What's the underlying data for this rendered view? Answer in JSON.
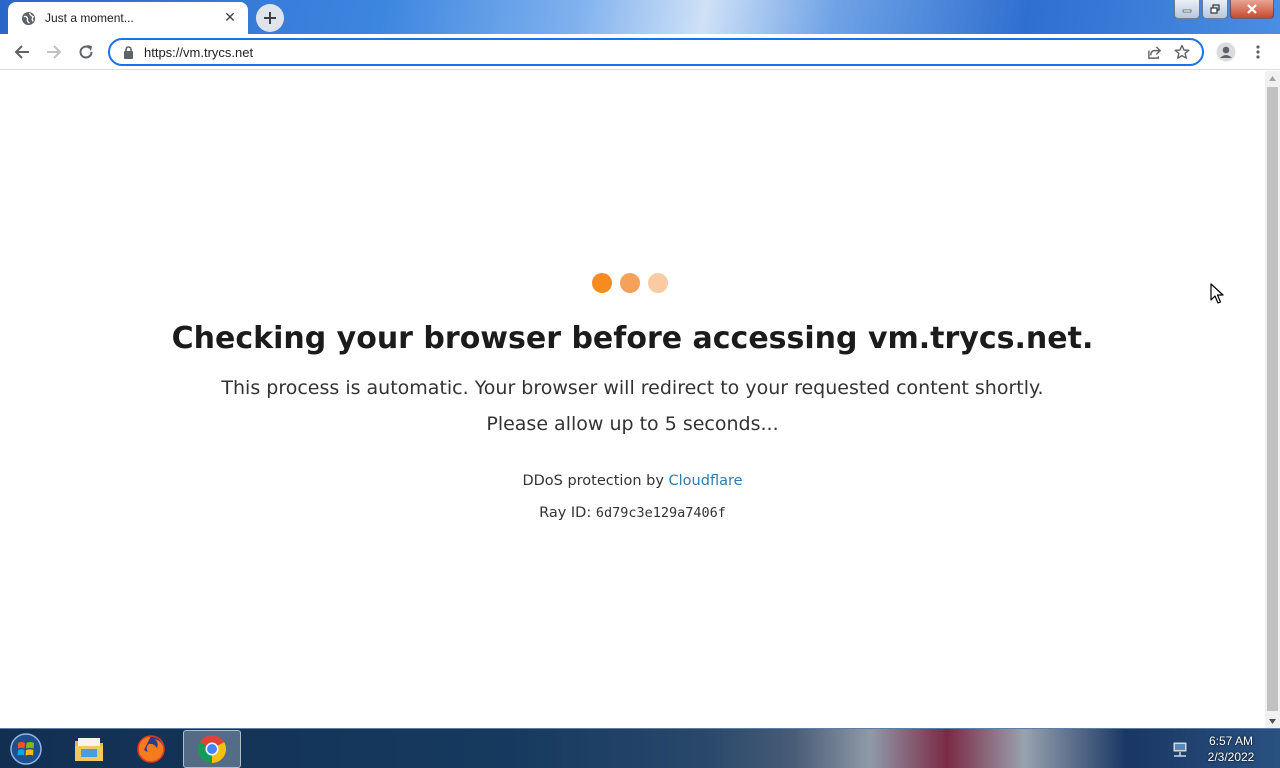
{
  "browser": {
    "tab": {
      "title": "Just a moment...",
      "favicon": "globe-icon"
    },
    "address_bar": {
      "url": "https://vm.trycs.net"
    },
    "accent_color": "#1a73e8"
  },
  "page": {
    "loader_dots": [
      "#f68b1f",
      "#f4a15a",
      "#fbcaa3"
    ],
    "heading": "Checking your browser before accessing vm.trycs.net.",
    "message": "This process is automatic. Your browser will redirect to your requested content shortly.",
    "wait_notice": "Please allow up to 5 seconds...",
    "ddos_prefix": "DDoS protection by",
    "ddos_link": "Cloudflare",
    "ray_label": "Ray ID:",
    "ray_id": "6d79c3e129a7406f"
  },
  "taskbar": {
    "apps": [
      "file-explorer-icon",
      "firefox-icon",
      "chrome-icon"
    ],
    "active_app": "chrome-icon",
    "clock_time": "6:57 AM",
    "clock_date": "2/3/2022"
  }
}
